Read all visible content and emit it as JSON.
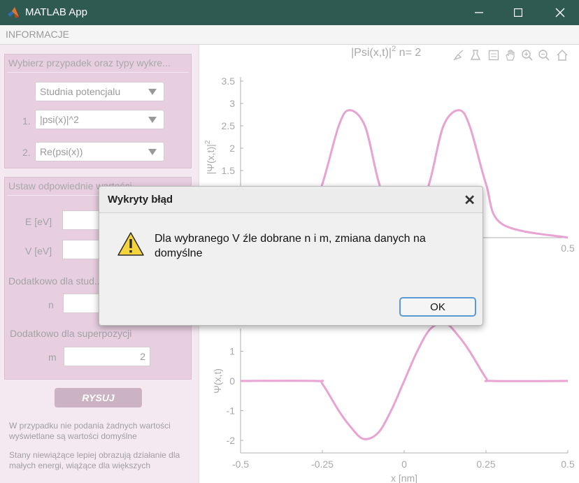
{
  "window": {
    "title": "MATLAB App"
  },
  "menu": {
    "informacje": "INFORMACJE"
  },
  "panel1": {
    "title": "Wybierz przypadek oraz typy wykre...",
    "case_select": "Studnia potencjalu",
    "plot1_index": "1.",
    "plot1_select": "|psi(x)|^2",
    "plot2_index": "2.",
    "plot2_select": "Re(psi(x))"
  },
  "panel2": {
    "title": "Ustaw odpowiednie wartości",
    "e_label": "E [eV]",
    "v_label": "V [eV]",
    "extra_label": "Dodatkowo dla stud...",
    "n_label": "n",
    "superposition_label": "Dodatkowo dla superpozycji",
    "m_label": "m",
    "m_value": "2"
  },
  "draw_button": "RYSUJ",
  "notes": {
    "note1": "W przypadku nie podania żadnych wartości wyświetlane są wartości domyślne",
    "note2": "Stany niewiążące lepiej obrazują działanie dla małych energi, wiążące dla większych"
  },
  "toolbar_icons": [
    "brush-icon",
    "data-tip-icon",
    "legend-icon",
    "pan-icon",
    "zoom-in-icon",
    "zoom-out-icon",
    "home-icon"
  ],
  "chart_data": [
    {
      "type": "line",
      "title": "|Psi(x,t)|^2  n=  2",
      "title_main": "|Psi(x,t)|",
      "title_sup": "2",
      "title_rest": "  n=  2",
      "ylabel": "|Ψ(x,t)|^2",
      "ylim": [
        0,
        3.5
      ],
      "yticks": [
        "3.5",
        "3",
        "2.5",
        "2",
        "1.5"
      ],
      "xtick_visible": "0.5",
      "color": "#e8a3d2",
      "x": [
        -0.5,
        -0.3,
        -0.25,
        -0.2,
        -0.167,
        -0.12,
        -0.08,
        -0.04,
        0,
        0.04,
        0.08,
        0.12,
        0.167,
        0.2,
        0.25,
        0.3,
        0.5
      ],
      "y": [
        0.0,
        0.3,
        1.2,
        2.5,
        2.85,
        2.5,
        1.3,
        0.4,
        0.0,
        0.4,
        1.3,
        2.5,
        2.85,
        2.5,
        1.2,
        0.3,
        0.0
      ]
    },
    {
      "type": "line",
      "ylabel": "Ψ(x,t)",
      "xlabel": "x [nm]",
      "ylim": [
        -2,
        1
      ],
      "xlim": [
        -0.5,
        0.5
      ],
      "yticks": [
        "1",
        "0",
        "-1",
        "-2"
      ],
      "xticks": [
        "-0.5",
        "-0.25",
        "0",
        "0.25",
        "0.5"
      ],
      "color": "#e8a3d2",
      "x": [
        -0.5,
        -0.27,
        -0.25,
        -0.2,
        -0.167,
        -0.125,
        -0.08,
        -0.04,
        0,
        0.04,
        0.08,
        0.125,
        0.167,
        0.2,
        0.25,
        0.27,
        0.5
      ],
      "y": [
        0.0,
        0.0,
        -0.1,
        -1.0,
        -1.5,
        -1.95,
        -1.75,
        -1.0,
        0.0,
        1.0,
        1.75,
        1.95,
        1.5,
        1.0,
        0.1,
        0.0,
        0.0
      ]
    }
  ],
  "dialog": {
    "title": "Wykryty błąd",
    "message": "Dla wybranego V źle dobrane n i m, zmiana danych na domyślne",
    "ok": "OK"
  }
}
